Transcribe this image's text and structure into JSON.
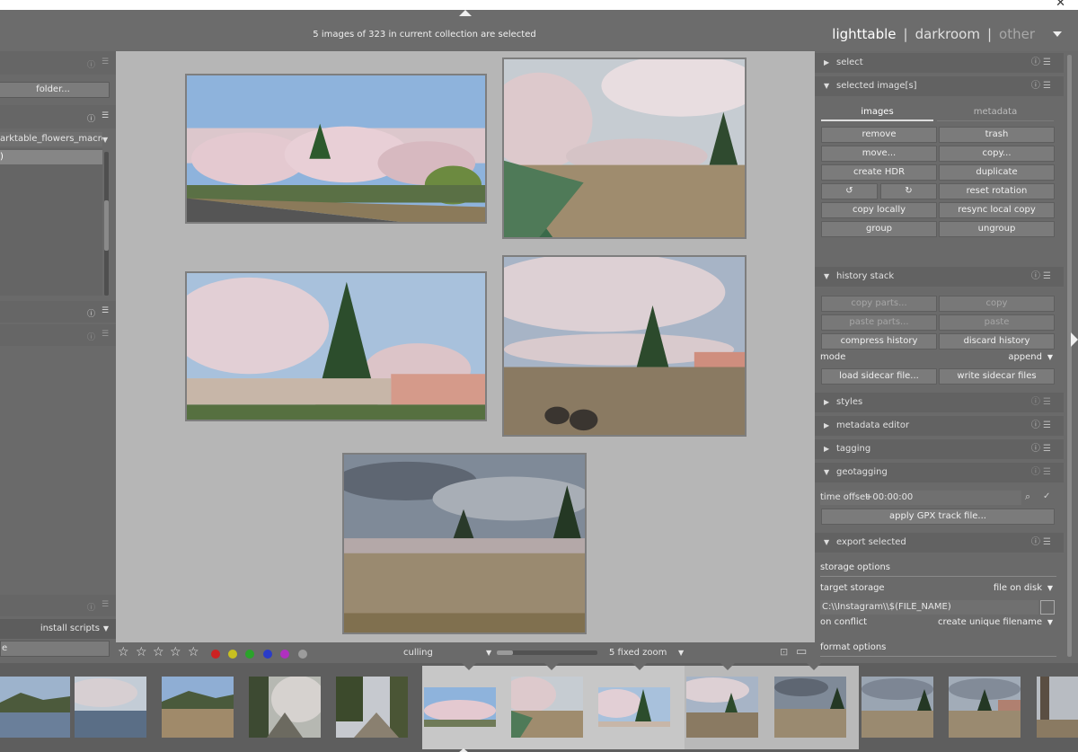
{
  "window": {
    "close_glyph": "✕"
  },
  "header": {
    "status_text": "5 images of 323 in current collection are selected",
    "views": [
      {
        "label": "lighttable"
      },
      {
        "label": "darkroom"
      },
      {
        "label": "other"
      }
    ],
    "separator": "|"
  },
  "left_panel": {
    "folder_button": "folder...",
    "collection_path": "arktable_flowers_macros",
    "selected_row_text": ")",
    "install_scripts": "install scripts",
    "bottom_field_text": "e"
  },
  "right_panel": {
    "sections": {
      "select": "select",
      "selected_images": "selected image[s]",
      "history_stack": "history stack",
      "styles": "styles",
      "metadata_editor": "metadata editor",
      "tagging": "tagging",
      "geotagging": "geotagging",
      "export_selected": "export selected"
    },
    "tabs": {
      "images": "images",
      "metadata": "metadata"
    },
    "image_buttons": {
      "remove": "remove",
      "trash": "trash",
      "move": "move...",
      "copy": "copy...",
      "create_hdr": "create HDR",
      "duplicate": "duplicate",
      "rotate_ccw": "↺",
      "rotate_cw": "↻",
      "reset_rotation": "reset rotation",
      "copy_locally": "copy locally",
      "resync_local_copy": "resync local copy",
      "group": "group",
      "ungroup": "ungroup"
    },
    "history_buttons": {
      "copy_parts": "copy parts...",
      "copy": "copy",
      "paste_parts": "paste parts...",
      "paste": "paste",
      "compress_history": "compress history",
      "discard_history": "discard history",
      "load_sidecar": "load sidecar file...",
      "write_sidecar": "write sidecar files"
    },
    "mode": {
      "label": "mode",
      "value": "append"
    },
    "geotagging": {
      "time_offset_label": "time offset",
      "time_offset_value": "+00:00:00",
      "apply_gpx": "apply GPX track file..."
    },
    "export": {
      "storage_options": "storage options",
      "target_storage_label": "target storage",
      "target_storage_value": "file on disk",
      "path_value": "C:\\\\Instagram\\\\$(FILE_NAME)",
      "on_conflict_label": "on conflict",
      "on_conflict_value": "create unique filename",
      "format_options": "format options"
    }
  },
  "bottom_bar": {
    "stars": [
      "☆",
      "☆",
      "☆",
      "☆",
      "☆"
    ],
    "color_labels": [
      "#cc2222",
      "#c8c020",
      "#2aa32a",
      "#2a3cc8",
      "#b030c0",
      "#9c9c9c"
    ],
    "layout_mode": "culling",
    "zoom": "5 fixed zoom"
  },
  "center": {
    "thumbnail_count": 5
  },
  "filmstrip": {
    "thumbnail_count": 13
  }
}
